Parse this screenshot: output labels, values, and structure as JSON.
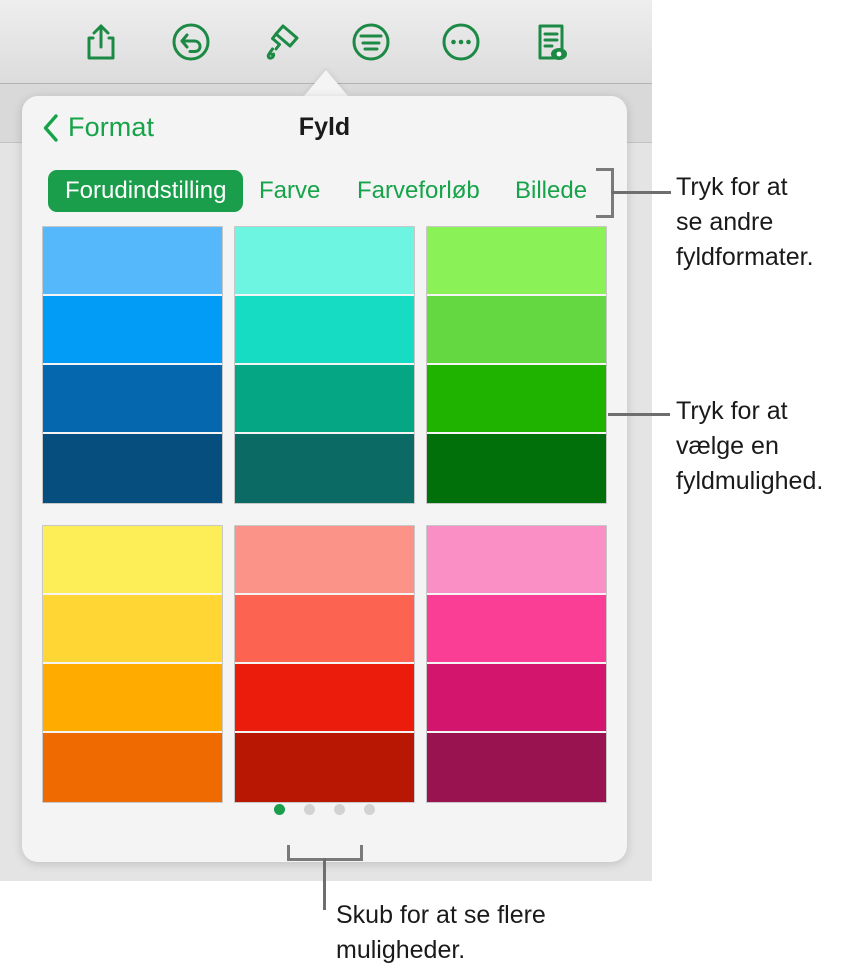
{
  "toolbar": {
    "buttons": [
      {
        "name": "share-icon",
        "label": "Del"
      },
      {
        "name": "undo-icon",
        "label": "Fortryd"
      },
      {
        "name": "paintbrush-icon",
        "label": "Format"
      },
      {
        "name": "insert-icon",
        "label": "Indsæt"
      },
      {
        "name": "more-icon",
        "label": "Mere"
      },
      {
        "name": "document-preview-icon",
        "label": "Dokument"
      }
    ]
  },
  "popover": {
    "back_label": "Format",
    "title": "Fyld",
    "tabs": [
      {
        "label": "Forudindstilling",
        "active": true
      },
      {
        "label": "Farve",
        "active": false
      },
      {
        "label": "Farveforløb",
        "active": false
      },
      {
        "label": "Billede",
        "active": false
      }
    ],
    "page_dots": {
      "count": 4,
      "active_index": 0,
      "active_color": "#1a9e4b",
      "inactive_color": "#d2d2d2"
    },
    "swatch_groups": [
      {
        "name": "blue",
        "colors": [
          "#55b8fa",
          "#029bf5",
          "#0568ae",
          "#054e7d"
        ]
      },
      {
        "name": "teal",
        "colors": [
          "#6ef5e2",
          "#16dcc4",
          "#04a684",
          "#0b6b64"
        ]
      },
      {
        "name": "green",
        "colors": [
          "#8af257",
          "#63d840",
          "#1fb300",
          "#02700a"
        ]
      },
      {
        "name": "yellow-orange",
        "colors": [
          "#fdee58",
          "#ffd633",
          "#ffab00",
          "#f06a02"
        ]
      },
      {
        "name": "red",
        "colors": [
          "#fb9389",
          "#fc6350",
          "#ec1c0d",
          "#b81703"
        ]
      },
      {
        "name": "pink-magenta",
        "colors": [
          "#f98fc5",
          "#fa3e96",
          "#d4156e",
          "#991350"
        ]
      }
    ]
  },
  "callouts": {
    "fill_formats": "Tryk for at\nse andre\nfyldformater.",
    "fill_option": "Tryk for at\nvælge en\nfyldmulighed.",
    "swipe_more": "Skub for at se flere\nmuligheder."
  },
  "colors": {
    "accent_green": "#17a34a",
    "tab_active_bg": "#1a9e4b",
    "leader_gray": "#6e6e6e",
    "popover_bg": "#f4f4f4"
  }
}
